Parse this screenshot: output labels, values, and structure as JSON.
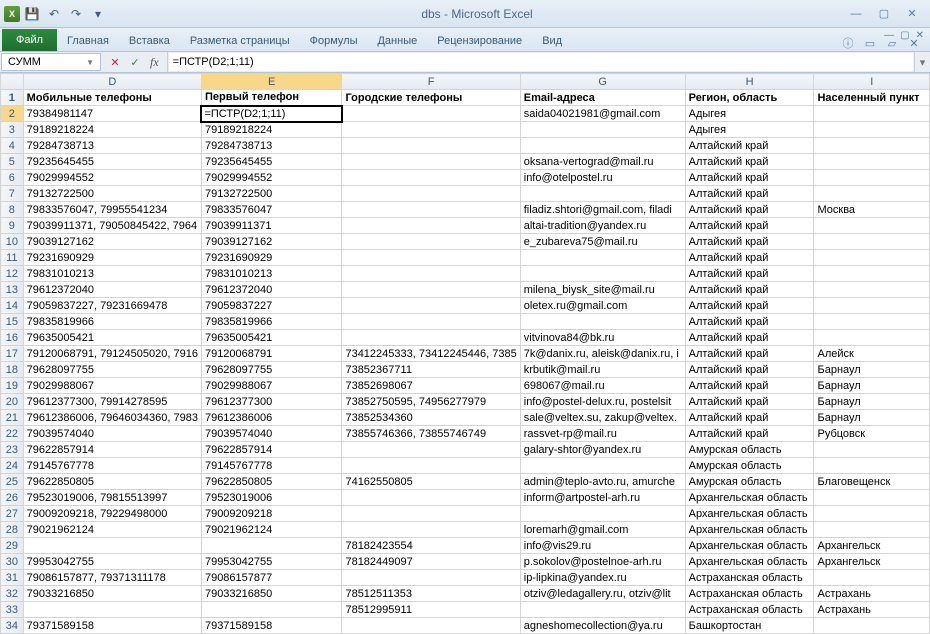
{
  "app": {
    "title": "dbs - Microsoft Excel"
  },
  "qat": {
    "save": "💾",
    "undo": "↶",
    "redo": "↷"
  },
  "ribbon": {
    "file": "Файл",
    "tabs": [
      "Главная",
      "Вставка",
      "Разметка страницы",
      "Формулы",
      "Данные",
      "Рецензирование",
      "Вид"
    ]
  },
  "formulabar": {
    "namebox": "СУММ",
    "formula": "=ПСТР(D2;1;11)"
  },
  "columns": [
    "D",
    "E",
    "F",
    "G",
    "H",
    "I"
  ],
  "colWidths": {
    "D": "col-D",
    "E": "col-E",
    "F": "col-F",
    "G": "col-G",
    "H": "col-H",
    "I": "col-I"
  },
  "headerRow": [
    "Мобильные телефоны",
    "Первый телефон",
    "Городские телефоны",
    "Email-адреса",
    "Регион, область",
    "Населенный пункт"
  ],
  "editingFormula": "=ПСТР(D2;1;11)",
  "rows": [
    {
      "n": 2,
      "D": "79384981147",
      "E": "",
      "F": "",
      "G": "saida04021981@gmail.com",
      "H": "Адыгея",
      "I": ""
    },
    {
      "n": 3,
      "D": "79189218224",
      "E": "79189218224",
      "F": "",
      "G": "",
      "H": "Адыгея",
      "I": ""
    },
    {
      "n": 4,
      "D": "79284738713",
      "E": "79284738713",
      "F": "",
      "G": "",
      "H": "Алтайский край",
      "I": ""
    },
    {
      "n": 5,
      "D": "79235645455",
      "E": "79235645455",
      "F": "",
      "G": "oksana-vertograd@mail.ru",
      "H": "Алтайский край",
      "I": ""
    },
    {
      "n": 6,
      "D": "79029994552",
      "E": "79029994552",
      "F": "",
      "G": "info@otelpostel.ru",
      "H": "Алтайский край",
      "I": ""
    },
    {
      "n": 7,
      "D": "79132722500",
      "E": "79132722500",
      "F": "",
      "G": "",
      "H": "Алтайский край",
      "I": ""
    },
    {
      "n": 8,
      "D": "79833576047, 79955541234",
      "E": "79833576047",
      "F": "",
      "G": "filadiz.shtori@gmail.com, filadi",
      "H": "Алтайский край",
      "I": "Москва"
    },
    {
      "n": 9,
      "D": "79039911371, 79050845422, 7964",
      "E": "79039911371",
      "F": "",
      "G": "altai-tradition@yandex.ru",
      "H": "Алтайский край",
      "I": ""
    },
    {
      "n": 10,
      "D": "79039127162",
      "E": "79039127162",
      "F": "",
      "G": "e_zubareva75@mail.ru",
      "H": "Алтайский край",
      "I": ""
    },
    {
      "n": 11,
      "D": "79231690929",
      "E": "79231690929",
      "F": "",
      "G": "",
      "H": "Алтайский край",
      "I": ""
    },
    {
      "n": 12,
      "D": "79831010213",
      "E": "79831010213",
      "F": "",
      "G": "",
      "H": "Алтайский край",
      "I": ""
    },
    {
      "n": 13,
      "D": "79612372040",
      "E": "79612372040",
      "F": "",
      "G": "milena_biysk_site@mail.ru",
      "H": "Алтайский край",
      "I": ""
    },
    {
      "n": 14,
      "D": "79059837227, 79231669478",
      "E": "79059837227",
      "F": "",
      "G": "oletex.ru@gmail.com",
      "H": "Алтайский край",
      "I": ""
    },
    {
      "n": 15,
      "D": "79835819966",
      "E": "79835819966",
      "F": "",
      "G": "",
      "H": "Алтайский край",
      "I": ""
    },
    {
      "n": 16,
      "D": "79635005421",
      "E": "79635005421",
      "F": "",
      "G": "vitvinova84@bk.ru",
      "H": "Алтайский край",
      "I": ""
    },
    {
      "n": 17,
      "D": "79120068791, 79124505020, 7916",
      "E": "79120068791",
      "F": "73412245333, 73412245446, 7385",
      "G": "7k@danix.ru, aleisk@danix.ru, i",
      "H": "Алтайский край",
      "I": "Алейск"
    },
    {
      "n": 18,
      "D": "79628097755",
      "E": "79628097755",
      "F": "73852367711",
      "G": "krbutik@mail.ru",
      "H": "Алтайский край",
      "I": "Барнаул"
    },
    {
      "n": 19,
      "D": "79029988067",
      "E": "79029988067",
      "F": "73852698067",
      "G": "698067@mail.ru",
      "H": "Алтайский край",
      "I": "Барнаул"
    },
    {
      "n": 20,
      "D": "79612377300, 79914278595",
      "E": "79612377300",
      "F": "73852750595, 74956277979",
      "G": "info@postel-delux.ru, postelsit",
      "H": "Алтайский край",
      "I": "Барнаул"
    },
    {
      "n": 21,
      "D": "79612386006, 79646034360, 7983",
      "E": "79612386006",
      "F": "73852534360",
      "G": "sale@veltex.su, zakup@veltex.",
      "H": "Алтайский край",
      "I": "Барнаул"
    },
    {
      "n": 22,
      "D": "79039574040",
      "E": "79039574040",
      "F": "73855746366, 73855746749",
      "G": "rassvet-rp@mail.ru",
      "H": "Алтайский край",
      "I": "Рубцовск"
    },
    {
      "n": 23,
      "D": "79622857914",
      "E": "79622857914",
      "F": "",
      "G": "galary-shtor@yandex.ru",
      "H": "Амурская область",
      "I": ""
    },
    {
      "n": 24,
      "D": "79145767778",
      "E": "79145767778",
      "F": "",
      "G": "",
      "H": "Амурская область",
      "I": ""
    },
    {
      "n": 25,
      "D": "79622850805",
      "E": "79622850805",
      "F": "74162550805",
      "G": "admin@teplo-avto.ru, amurche",
      "H": "Амурская область",
      "I": "Благовещенск"
    },
    {
      "n": 26,
      "D": "79523019006, 79815513997",
      "E": "79523019006",
      "F": "",
      "G": "inform@artpostel-arh.ru",
      "H": "Архангельская область",
      "I": ""
    },
    {
      "n": 27,
      "D": "79009209218, 79229498000",
      "E": "79009209218",
      "F": "",
      "G": "",
      "H": "Архангельская область",
      "I": ""
    },
    {
      "n": 28,
      "D": "79021962124",
      "E": "79021962124",
      "F": "",
      "G": "loremarh@gmail.com",
      "H": "Архангельская область",
      "I": ""
    },
    {
      "n": 29,
      "D": "",
      "E": "",
      "F": "78182423554",
      "G": "info@vis29.ru",
      "H": "Архангельская область",
      "I": "Архангельск"
    },
    {
      "n": 30,
      "D": "79953042755",
      "E": "79953042755",
      "F": "78182449097",
      "G": "p.sokolov@postelnoe-arh.ru",
      "H": "Архангельская область",
      "I": "Архангельск"
    },
    {
      "n": 31,
      "D": "79086157877, 79371311178",
      "E": "79086157877",
      "F": "",
      "G": "ip-lipkina@yandex.ru",
      "H": "Астраханская область",
      "I": ""
    },
    {
      "n": 32,
      "D": "79033216850",
      "E": "79033216850",
      "F": "78512511353",
      "G": "otziv@ledagallery.ru, otziv@lit",
      "H": "Астраханская область",
      "I": "Астрахань"
    },
    {
      "n": 33,
      "D": "",
      "E": "",
      "F": "78512995911",
      "G": "",
      "H": "Астраханская область",
      "I": "Астрахань"
    },
    {
      "n": 34,
      "D": "79371589158",
      "E": "79371589158",
      "F": "",
      "G": "agneshomecollection@ya.ru",
      "H": "Башкортостан",
      "I": ""
    }
  ]
}
